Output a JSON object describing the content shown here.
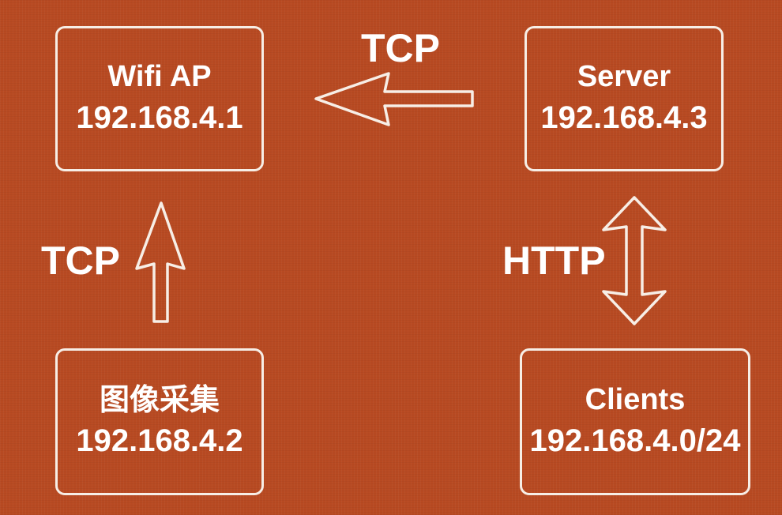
{
  "nodes": {
    "wifi_ap": {
      "name": "Wifi AP",
      "ip": "192.168.4.1"
    },
    "server": {
      "name": "Server",
      "ip": "192.168.4.3"
    },
    "camera": {
      "name": "图像采集",
      "ip": "192.168.4.2"
    },
    "clients": {
      "name": "Clients",
      "ip": "192.168.4.0/24"
    }
  },
  "edges": {
    "server_to_ap": {
      "label": "TCP",
      "direction": "left"
    },
    "camera_to_ap": {
      "label": "TCP",
      "direction": "up"
    },
    "server_clients": {
      "label": "HTTP",
      "direction": "bidirectional"
    }
  },
  "colors": {
    "background": "#b84a22",
    "stroke": "#f7eee6",
    "text": "#ffffff"
  }
}
